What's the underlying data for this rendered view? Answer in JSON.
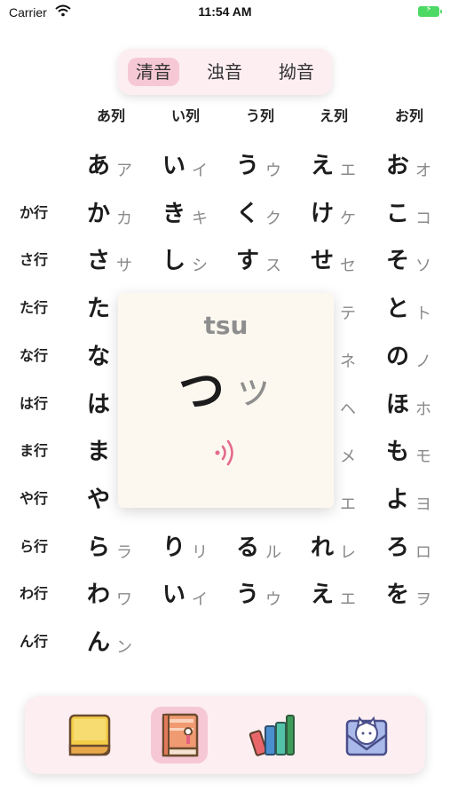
{
  "status_bar": {
    "carrier": "Carrier",
    "time": "11:54 AM"
  },
  "segments": [
    "清音",
    "浊音",
    "拗音"
  ],
  "selected_segment": 0,
  "columns": [
    "あ列",
    "い列",
    "う列",
    "え列",
    "お列"
  ],
  "rows": [
    {
      "label": "",
      "cells": [
        [
          "あ",
          "ア"
        ],
        [
          "い",
          "イ"
        ],
        [
          "う",
          "ウ"
        ],
        [
          "え",
          "エ"
        ],
        [
          "お",
          "オ"
        ]
      ]
    },
    {
      "label": "か行",
      "cells": [
        [
          "か",
          "カ"
        ],
        [
          "き",
          "キ"
        ],
        [
          "く",
          "ク"
        ],
        [
          "け",
          "ケ"
        ],
        [
          "こ",
          "コ"
        ]
      ]
    },
    {
      "label": "さ行",
      "cells": [
        [
          "さ",
          "サ"
        ],
        [
          "し",
          "シ"
        ],
        [
          "す",
          "ス"
        ],
        [
          "せ",
          "セ"
        ],
        [
          "そ",
          "ソ"
        ]
      ]
    },
    {
      "label": "た行",
      "cells": [
        [
          "た",
          ""
        ],
        null,
        null,
        [
          "",
          "テ"
        ],
        [
          "と",
          "ト"
        ]
      ]
    },
    {
      "label": "な行",
      "cells": [
        [
          "な",
          ""
        ],
        null,
        null,
        [
          "",
          "ネ"
        ],
        [
          "の",
          "ノ"
        ]
      ]
    },
    {
      "label": "は行",
      "cells": [
        [
          "は",
          ""
        ],
        null,
        null,
        [
          "",
          "ヘ"
        ],
        [
          "ほ",
          "ホ"
        ]
      ]
    },
    {
      "label": "ま行",
      "cells": [
        [
          "ま",
          ""
        ],
        null,
        null,
        [
          "",
          "メ"
        ],
        [
          "も",
          "モ"
        ]
      ]
    },
    {
      "label": "や行",
      "cells": [
        [
          "や",
          ""
        ],
        null,
        null,
        [
          "",
          "エ"
        ],
        [
          "よ",
          "ヨ"
        ]
      ]
    },
    {
      "label": "ら行",
      "cells": [
        [
          "ら",
          "ラ"
        ],
        [
          "り",
          "リ"
        ],
        [
          "る",
          "ル"
        ],
        [
          "れ",
          "レ"
        ],
        [
          "ろ",
          "ロ"
        ]
      ]
    },
    {
      "label": "わ行",
      "cells": [
        [
          "わ",
          "ワ"
        ],
        [
          "い",
          "イ"
        ],
        [
          "う",
          "ウ"
        ],
        [
          "え",
          "エ"
        ],
        [
          "を",
          "ヲ"
        ]
      ]
    },
    {
      "label": "ん行",
      "cells": [
        [
          "ん",
          "ン"
        ],
        null,
        null,
        null,
        null
      ]
    }
  ],
  "popup": {
    "romaji": "tsu",
    "hiragana": "つ",
    "katakana": "ッ",
    "icon": "sound-icon"
  },
  "tabbar": {
    "selected": 1,
    "tabs": [
      {
        "icon": "sticky-note-icon"
      },
      {
        "icon": "book-icon"
      },
      {
        "icon": "books-icon"
      },
      {
        "icon": "cat-envelope-icon"
      }
    ]
  },
  "colors": {
    "accent": "#f6c8d5",
    "panel_bg": "#fdeef2",
    "card_bg": "#fcf8ef",
    "sound": "#e46a8c"
  }
}
